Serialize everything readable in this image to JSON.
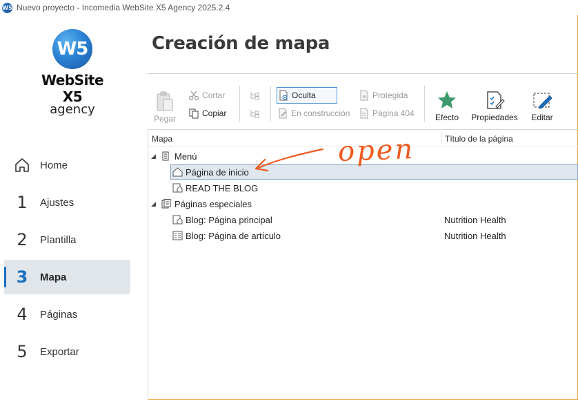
{
  "window": {
    "title": "Nuevo proyecto - Incomedia WebSite X5 Agency 2025.2.4"
  },
  "logo": {
    "mark": "W5",
    "name": "WebSite X5",
    "edition": "agency"
  },
  "nav": {
    "items": [
      {
        "num": "",
        "label": "Home",
        "icon": "home-icon"
      },
      {
        "num": "1",
        "label": "Ajustes"
      },
      {
        "num": "2",
        "label": "Plantilla"
      },
      {
        "num": "3",
        "label": "Mapa",
        "active": true
      },
      {
        "num": "4",
        "label": "Páginas"
      },
      {
        "num": "5",
        "label": "Exportar"
      }
    ]
  },
  "page": {
    "title": "Creación de mapa"
  },
  "toolbar": {
    "paste": "Pegar",
    "cut": "Cortar",
    "copy": "Copiar",
    "hidden": "Oculta",
    "under_construction": "En construcción",
    "protected": "Protegida",
    "page404": "Página 404",
    "effect": "Efecto",
    "properties": "Propiedades",
    "edit": "Editar"
  },
  "table": {
    "col_map": "Mapa",
    "col_title": "Título de la página",
    "rows": [
      {
        "label": "Menú",
        "title": ""
      },
      {
        "label": "Página de inicio",
        "title": ""
      },
      {
        "label": "READ THE BLOG",
        "title": ""
      },
      {
        "label": "Páginas especiales",
        "title": ""
      },
      {
        "label": "Blog: Página principal",
        "title": "Nutrition Health"
      },
      {
        "label": "Blog: Página de artículo",
        "title": "Nutrition Health"
      }
    ]
  },
  "annotation": {
    "text": "open",
    "color": "#f05a1e"
  },
  "colors": {
    "accent": "#1b6ec2",
    "annotation": "#f05a1e",
    "selection": "#dfe6ee"
  }
}
